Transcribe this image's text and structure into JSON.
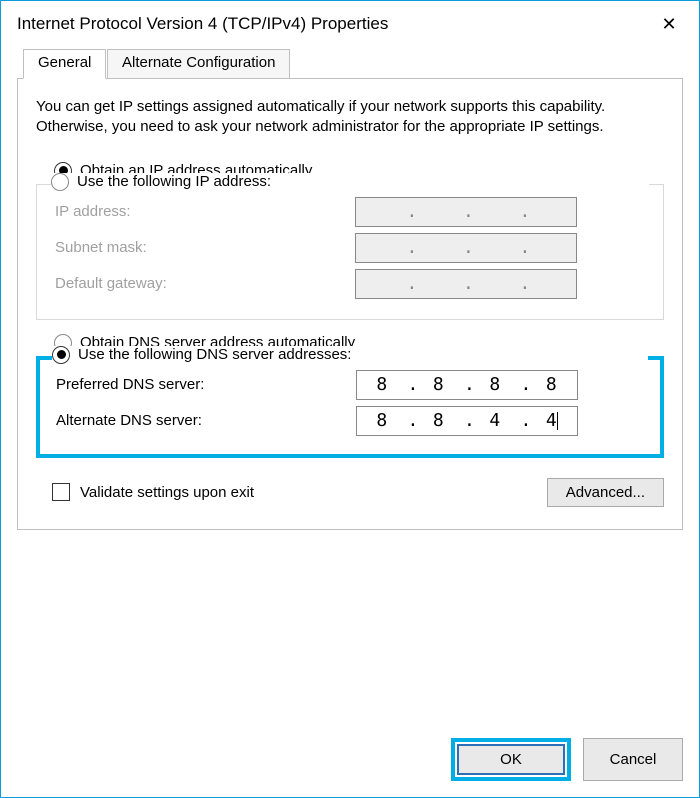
{
  "window": {
    "title": "Internet Protocol Version 4 (TCP/IPv4) Properties"
  },
  "tabs": {
    "general": "General",
    "alternate": "Alternate Configuration"
  },
  "description": "You can get IP settings assigned automatically if your network supports this capability. Otherwise, you need to ask your network administrator for the appropriate IP settings.",
  "ip": {
    "auto_label": "Obtain an IP address automatically",
    "manual_label": "Use the following IP address:",
    "ip_label": "IP address:",
    "subnet_label": "Subnet mask:",
    "gateway_label": "Default gateway:"
  },
  "dns": {
    "auto_label": "Obtain DNS server address automatically",
    "manual_label": "Use the following DNS server addresses:",
    "preferred_label": "Preferred DNS server:",
    "alternate_label": "Alternate DNS server:",
    "preferred": {
      "o1": "8",
      "o2": "8",
      "o3": "8",
      "o4": "8"
    },
    "alternate": {
      "o1": "8",
      "o2": "8",
      "o3": "4",
      "o4": "4"
    }
  },
  "validate_label": "Validate settings upon exit",
  "buttons": {
    "advanced": "Advanced...",
    "ok": "OK",
    "cancel": "Cancel"
  }
}
